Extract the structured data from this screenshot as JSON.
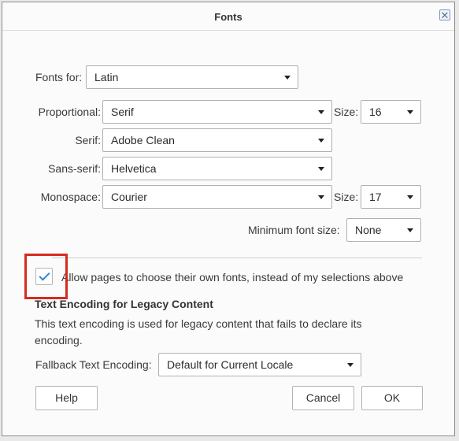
{
  "dialog": {
    "title": "Fonts",
    "close_symbol": "✕"
  },
  "fonts_for": {
    "label": "Fonts for:",
    "value": "Latin"
  },
  "proportional": {
    "label": "Proportional:",
    "value": "Serif",
    "size_label": "Size:",
    "size_value": "16"
  },
  "serif": {
    "label": "Serif:",
    "value": "Adobe Clean"
  },
  "sans_serif": {
    "label": "Sans-serif:",
    "value": "Helvetica"
  },
  "monospace": {
    "label": "Monospace:",
    "value": "Courier",
    "size_label": "Size:",
    "size_value": "17"
  },
  "minimum_font_size": {
    "label": "Minimum font size:",
    "value": "None"
  },
  "allow_pages": {
    "label": "Allow pages to choose their own fonts, instead of my selections above",
    "checked": true
  },
  "text_encoding": {
    "heading": "Text Encoding for Legacy Content",
    "description": "This text encoding is used for legacy content that fails to declare its encoding.",
    "fallback_label": "Fallback Text Encoding:",
    "fallback_value": "Default for Current Locale"
  },
  "buttons": {
    "help": "Help",
    "cancel": "Cancel",
    "ok": "OK"
  },
  "icons": {
    "close": "close-icon",
    "dropdown": "chevron-down-icon",
    "check": "checkmark-icon"
  },
  "colors": {
    "highlight": "#d52b1e",
    "check": "#2f88d1"
  }
}
